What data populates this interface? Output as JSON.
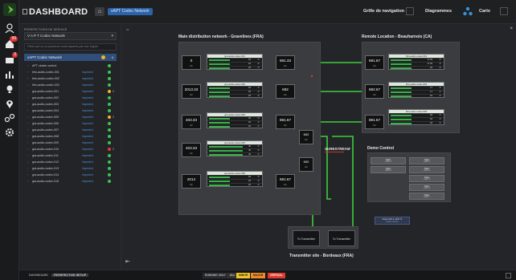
{
  "app": {
    "title": "DASHBOARD",
    "perspective_badge": "vAPT Codec Network"
  },
  "nav": {
    "grid": "Grille de navigation",
    "diagrams": "Diagrammes",
    "map": "Carte"
  },
  "sidebar_badges": {
    "alarms": "99",
    "notifications": "3"
  },
  "panel": {
    "caption": "PERSPECTIVES DE SERVICE",
    "selected": "V A P T Codec Network",
    "filter_placeholder": "Filtrer par un ou plusieurs mots séparés par une virgule",
    "header": "vAPT Codec Network",
    "header_count": "4",
    "tree": [
      {
        "label": "APT cluster control",
        "status": "",
        "level": "ok",
        "count": ""
      },
      {
        "label": "bhs-audio-codec-001",
        "status": "Inspected",
        "level": "ok",
        "count": ""
      },
      {
        "label": "bhs-audio-codec-002",
        "status": "Inspected",
        "level": "ok",
        "count": ""
      },
      {
        "label": "bhs-audio-codec-003",
        "status": "Inspected",
        "level": "ok",
        "count": ""
      },
      {
        "label": "gra-audio-codec-001",
        "status": "Inspected",
        "level": "warn",
        "count": "2"
      },
      {
        "label": "gra-audio-codec-002",
        "status": "Inspected",
        "level": "ok",
        "count": ""
      },
      {
        "label": "gra-audio-codec-003",
        "status": "Inspected",
        "level": "ok",
        "count": ""
      },
      {
        "label": "gra-audio-codec-004",
        "status": "Inspected",
        "level": "ok",
        "count": ""
      },
      {
        "label": "gra-audio-codec-005",
        "status": "Inspected",
        "level": "warn",
        "count": "2"
      },
      {
        "label": "gra-audio-codec-006",
        "status": "Inspected",
        "level": "ok",
        "count": ""
      },
      {
        "label": "gra-audio-codec-007",
        "status": "Inspected",
        "level": "ok",
        "count": ""
      },
      {
        "label": "gra-audio-codec-008",
        "status": "Inspected",
        "level": "ok",
        "count": ""
      },
      {
        "label": "gra-audio-codec-009",
        "status": "Inspected",
        "level": "ok",
        "count": ""
      },
      {
        "label": "gra-audio-codec-010",
        "status": "Inspected",
        "level": "crit",
        "count": "2"
      },
      {
        "label": "gra-audio-codec-011",
        "status": "Inspected",
        "level": "ok",
        "count": ""
      },
      {
        "label": "gra-audio-codec-012",
        "status": "Inspected",
        "level": "ok",
        "count": ""
      },
      {
        "label": "gra-audio-codec-013",
        "status": "Inspected",
        "level": "ok",
        "count": ""
      },
      {
        "label": "gra-audio-codec-014",
        "status": "Inspected",
        "level": "ok",
        "count": ""
      },
      {
        "label": "gra-audio-codec-015",
        "status": "Inspected",
        "level": "ok",
        "count": ""
      }
    ]
  },
  "diagram": {
    "main_group": "Main distribution network - Gravelines (FRA)",
    "remote_group": "Remote Location - Beauharnois (CA)",
    "transmitter_group": "Transmitter site - Bordeaux (FRA)",
    "demo_group": "Demo Control",
    "brand": "SURESTREAM",
    "left_nodes": [
      "0",
      "2013.33",
      "403.33",
      "403.33",
      "2014"
    ],
    "mid_nodes": [
      "691.33",
      "692",
      "691.67",
      "692",
      "691.67"
    ],
    "remote_nodes": [
      "691.67",
      "692.67",
      "691.67"
    ],
    "mid_links": [
      "692",
      "692"
    ],
    "node_unit": "kbit",
    "codecs_main": [
      {
        "name": "gra-audio-codec-001",
        "values": [
          "18",
          "18",
          "18"
        ]
      },
      {
        "name": "gra-audio-codec-002",
        "values": [
          "18",
          "18",
          "18"
        ]
      },
      {
        "name": "gra-audio-codec-003",
        "values": [
          "18",
          "18",
          "18"
        ]
      },
      {
        "name": "gra-audio-codec-004",
        "values": [
          "40",
          "40",
          "40"
        ]
      },
      {
        "name": "gra-audio-codec-005",
        "values": [
          "18",
          "18",
          "18"
        ]
      }
    ],
    "codecs_remote": [
      {
        "name": "bhs-audio-codec-001",
        "values": [
          "17.33",
          "17.33",
          "18"
        ]
      },
      {
        "name": "bhs-audio-codec-002",
        "values": [
          "17",
          "17",
          "18"
        ]
      },
      {
        "name": "bhs-audio-codec-003",
        "values": [
          "18",
          "18",
          "18"
        ]
      }
    ],
    "codec_unit": "dB",
    "transmitters": [
      "To Transmitter",
      "To Transmitter"
    ],
    "demo_buttons": [
      {
        "label": "Start",
        "sub": "codec 1"
      },
      {
        "label": "Start",
        "sub": "codec 2"
      },
      {
        "label": "Start",
        "sub": "codec 3"
      },
      {
        "label": "Start",
        "sub": "codec 4"
      },
      {
        "label": "Start",
        "sub": "codec 5"
      },
      {
        "label": "Start",
        "sub": "codec 6"
      },
      {
        "label": "Start",
        "sub": "codec 7"
      }
    ],
    "demo_link": "https://10.1.125.71",
    "demo_link_sub": "Admin console"
  },
  "bottom": {
    "tab_dashboard": "DASHBOARD",
    "tab_setup": "PERSPECTIVE SETUP",
    "running": "RUNNING ONLY",
    "chip_all": "ALL",
    "chip_minor": "MINOR",
    "chip_major": "MAJOR",
    "chip_critical": "CRITICAL"
  },
  "colors": {
    "link_green": "#3ccf3c",
    "accent_blue": "#2c63a8",
    "warn": "#f0b428",
    "critical": "#e03a2c"
  }
}
